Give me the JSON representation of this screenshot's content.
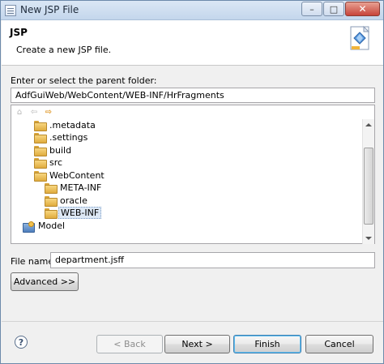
{
  "window": {
    "title": "New JSP File",
    "minimize_glyph": "–",
    "maximize_glyph": "□",
    "close_glyph": "✕"
  },
  "header": {
    "title": "JSP",
    "description": "Create a new JSP file.",
    "icon": "jsp-wizard-icon"
  },
  "parent_folder": {
    "label": "Enter or select the parent folder:",
    "value": "AdfGuiWeb/WebContent/WEB-INF/HrFragments"
  },
  "tree_toolbar": {
    "home_icon": "home-icon",
    "back_icon": "back-arrow-icon",
    "forward_icon": "forward-arrow-icon"
  },
  "tree": {
    "items": [
      {
        "label": ".metadata",
        "icon": "folder-icon",
        "level": 1,
        "selected": false
      },
      {
        "label": ".settings",
        "icon": "folder-icon",
        "level": 1,
        "selected": false
      },
      {
        "label": "build",
        "icon": "folder-icon",
        "level": 1,
        "selected": false
      },
      {
        "label": "src",
        "icon": "folder-icon",
        "level": 1,
        "selected": false
      },
      {
        "label": "WebContent",
        "icon": "folder-icon",
        "level": 1,
        "selected": false
      },
      {
        "label": "META-INF",
        "icon": "folder-icon",
        "level": 2,
        "selected": false
      },
      {
        "label": "oracle",
        "icon": "folder-icon",
        "level": 2,
        "selected": false
      },
      {
        "label": "WEB-INF",
        "icon": "folder-icon",
        "level": 2,
        "selected": true
      },
      {
        "label": "Model",
        "icon": "project-icon",
        "level": 0,
        "selected": false
      }
    ]
  },
  "file_name": {
    "label": "File name:",
    "value": "department.jsff"
  },
  "buttons": {
    "advanced": "Advanced >>",
    "back": "< Back",
    "next": "Next >",
    "finish": "Finish",
    "cancel": "Cancel",
    "help": "?"
  }
}
